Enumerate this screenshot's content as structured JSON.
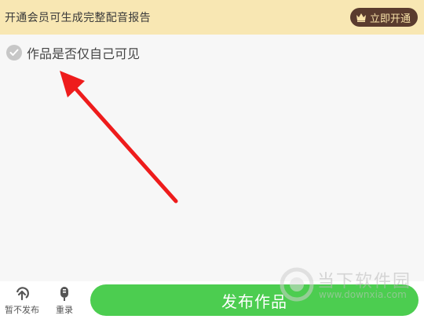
{
  "vip_banner": {
    "message": "开通会员可生成完整配音报告",
    "button_label": "立即开通",
    "background": "#f8e7b3",
    "button_color": "#5a3b2e"
  },
  "privacy_option": {
    "label": "作品是否仅自己可见",
    "checked": false,
    "icon": "check-icon"
  },
  "annotation": {
    "color": "#ee1c1c",
    "icon": "red-arrow"
  },
  "bottom_bar": {
    "unpublish_label": "暂不发布",
    "rerecord_label": "重录",
    "publish_label": "发布作品",
    "publish_color": "#4ccd50"
  },
  "watermark": {
    "brand": "当下软件园",
    "url": "www.downxia.com"
  }
}
